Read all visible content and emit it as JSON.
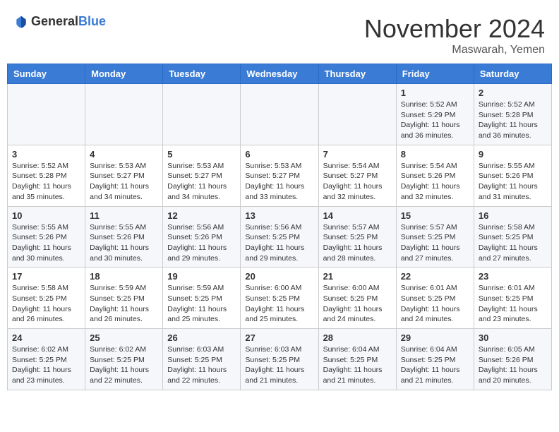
{
  "header": {
    "logo": {
      "general": "General",
      "blue": "Blue"
    },
    "title": "November 2024",
    "location": "Maswarah, Yemen"
  },
  "weekdays": [
    "Sunday",
    "Monday",
    "Tuesday",
    "Wednesday",
    "Thursday",
    "Friday",
    "Saturday"
  ],
  "weeks": [
    [
      {
        "day": "",
        "info": ""
      },
      {
        "day": "",
        "info": ""
      },
      {
        "day": "",
        "info": ""
      },
      {
        "day": "",
        "info": ""
      },
      {
        "day": "",
        "info": ""
      },
      {
        "day": "1",
        "info": "Sunrise: 5:52 AM\nSunset: 5:29 PM\nDaylight: 11 hours and 36 minutes."
      },
      {
        "day": "2",
        "info": "Sunrise: 5:52 AM\nSunset: 5:28 PM\nDaylight: 11 hours and 36 minutes."
      }
    ],
    [
      {
        "day": "3",
        "info": "Sunrise: 5:52 AM\nSunset: 5:28 PM\nDaylight: 11 hours and 35 minutes."
      },
      {
        "day": "4",
        "info": "Sunrise: 5:53 AM\nSunset: 5:27 PM\nDaylight: 11 hours and 34 minutes."
      },
      {
        "day": "5",
        "info": "Sunrise: 5:53 AM\nSunset: 5:27 PM\nDaylight: 11 hours and 34 minutes."
      },
      {
        "day": "6",
        "info": "Sunrise: 5:53 AM\nSunset: 5:27 PM\nDaylight: 11 hours and 33 minutes."
      },
      {
        "day": "7",
        "info": "Sunrise: 5:54 AM\nSunset: 5:27 PM\nDaylight: 11 hours and 32 minutes."
      },
      {
        "day": "8",
        "info": "Sunrise: 5:54 AM\nSunset: 5:26 PM\nDaylight: 11 hours and 32 minutes."
      },
      {
        "day": "9",
        "info": "Sunrise: 5:55 AM\nSunset: 5:26 PM\nDaylight: 11 hours and 31 minutes."
      }
    ],
    [
      {
        "day": "10",
        "info": "Sunrise: 5:55 AM\nSunset: 5:26 PM\nDaylight: 11 hours and 30 minutes."
      },
      {
        "day": "11",
        "info": "Sunrise: 5:55 AM\nSunset: 5:26 PM\nDaylight: 11 hours and 30 minutes."
      },
      {
        "day": "12",
        "info": "Sunrise: 5:56 AM\nSunset: 5:26 PM\nDaylight: 11 hours and 29 minutes."
      },
      {
        "day": "13",
        "info": "Sunrise: 5:56 AM\nSunset: 5:25 PM\nDaylight: 11 hours and 29 minutes."
      },
      {
        "day": "14",
        "info": "Sunrise: 5:57 AM\nSunset: 5:25 PM\nDaylight: 11 hours and 28 minutes."
      },
      {
        "day": "15",
        "info": "Sunrise: 5:57 AM\nSunset: 5:25 PM\nDaylight: 11 hours and 27 minutes."
      },
      {
        "day": "16",
        "info": "Sunrise: 5:58 AM\nSunset: 5:25 PM\nDaylight: 11 hours and 27 minutes."
      }
    ],
    [
      {
        "day": "17",
        "info": "Sunrise: 5:58 AM\nSunset: 5:25 PM\nDaylight: 11 hours and 26 minutes."
      },
      {
        "day": "18",
        "info": "Sunrise: 5:59 AM\nSunset: 5:25 PM\nDaylight: 11 hours and 26 minutes."
      },
      {
        "day": "19",
        "info": "Sunrise: 5:59 AM\nSunset: 5:25 PM\nDaylight: 11 hours and 25 minutes."
      },
      {
        "day": "20",
        "info": "Sunrise: 6:00 AM\nSunset: 5:25 PM\nDaylight: 11 hours and 25 minutes."
      },
      {
        "day": "21",
        "info": "Sunrise: 6:00 AM\nSunset: 5:25 PM\nDaylight: 11 hours and 24 minutes."
      },
      {
        "day": "22",
        "info": "Sunrise: 6:01 AM\nSunset: 5:25 PM\nDaylight: 11 hours and 24 minutes."
      },
      {
        "day": "23",
        "info": "Sunrise: 6:01 AM\nSunset: 5:25 PM\nDaylight: 11 hours and 23 minutes."
      }
    ],
    [
      {
        "day": "24",
        "info": "Sunrise: 6:02 AM\nSunset: 5:25 PM\nDaylight: 11 hours and 23 minutes."
      },
      {
        "day": "25",
        "info": "Sunrise: 6:02 AM\nSunset: 5:25 PM\nDaylight: 11 hours and 22 minutes."
      },
      {
        "day": "26",
        "info": "Sunrise: 6:03 AM\nSunset: 5:25 PM\nDaylight: 11 hours and 22 minutes."
      },
      {
        "day": "27",
        "info": "Sunrise: 6:03 AM\nSunset: 5:25 PM\nDaylight: 11 hours and 21 minutes."
      },
      {
        "day": "28",
        "info": "Sunrise: 6:04 AM\nSunset: 5:25 PM\nDaylight: 11 hours and 21 minutes."
      },
      {
        "day": "29",
        "info": "Sunrise: 6:04 AM\nSunset: 5:25 PM\nDaylight: 11 hours and 21 minutes."
      },
      {
        "day": "30",
        "info": "Sunrise: 6:05 AM\nSunset: 5:26 PM\nDaylight: 11 hours and 20 minutes."
      }
    ]
  ]
}
